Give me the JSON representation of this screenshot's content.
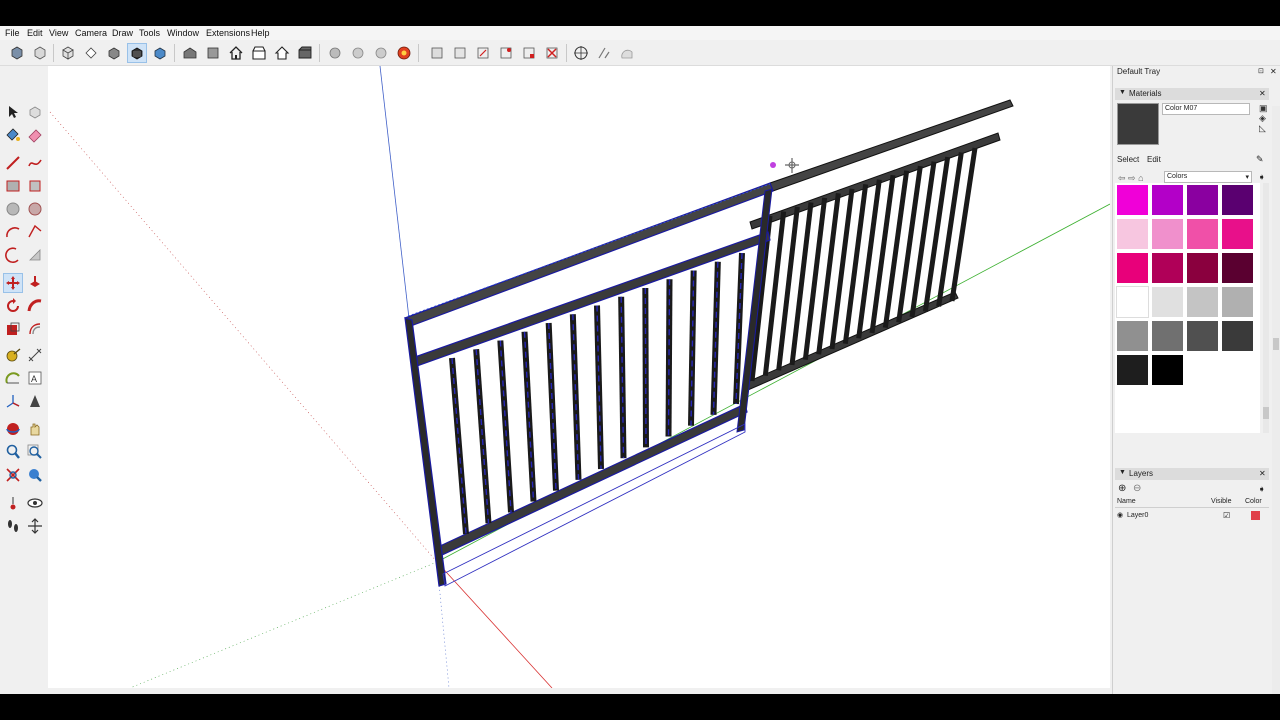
{
  "menu": [
    "File",
    "Edit",
    "View",
    "Camera",
    "Draw",
    "Tools",
    "Window",
    "Extensions",
    "Help"
  ],
  "tray": {
    "title": "Default Tray",
    "pin_glyph": "⊡",
    "close_glyph": "✕"
  },
  "materials": {
    "title": "Materials",
    "name_value": "Color M07",
    "tab_select": "Select",
    "tab_edit": "Edit",
    "library": "Colors",
    "current_color": "#3a3a3a",
    "swatches": [
      "#f000d8",
      "#b300c8",
      "#8a00a0",
      "#5a0070",
      "#f7c6e0",
      "#f090cc",
      "#f050a8",
      "#e8108a",
      "#e8007a",
      "#b00058",
      "#8a003e",
      "#5a0030",
      "#ffffff",
      "#e0e0e0",
      "#c4c4c4",
      "#b0b0b0",
      "#909090",
      "#707070",
      "#505050",
      "#3a3a3a",
      "#1e1e1e",
      "#000000"
    ]
  },
  "layers": {
    "title": "Layers",
    "col_name": "Name",
    "col_visible": "Visible",
    "col_color": "Color",
    "rows": [
      {
        "name": "Layer0",
        "visible": "☑",
        "color": "#e0404a"
      }
    ]
  },
  "icons": {
    "toolbar": [
      "select-icon",
      "eraser-icon",
      "paint-bucket-icon",
      "component-icon",
      "orbit-icon",
      "pan-icon",
      "zoom-icon",
      "zoom-extents-icon",
      "section-plane-icon",
      "house-icon",
      "warehouse-icon",
      "extension-icon",
      "iso-view-icon",
      "top-view-icon",
      "front-view-icon",
      "right-view-icon",
      "back-view-icon",
      "left-view-icon",
      "xray-icon",
      "wireframe-icon",
      "shaded-icon",
      "shaded-texture-icon",
      "monochrome-icon"
    ]
  }
}
